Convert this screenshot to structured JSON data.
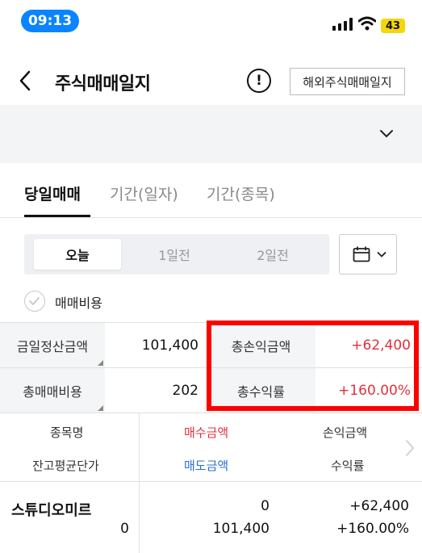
{
  "status_bar": {
    "time": "09:13",
    "battery": "43"
  },
  "header": {
    "title": "주식매매일지",
    "info_icon": "info-circle-icon",
    "overseas_button": "해외주식매매일지"
  },
  "tabs": [
    {
      "label": "당일매매",
      "active": true
    },
    {
      "label": "기간(일자)",
      "active": false
    },
    {
      "label": "기간(종목)",
      "active": false
    }
  ],
  "day_selector": {
    "options": [
      "오늘",
      "1일전",
      "2일전"
    ],
    "selected": "오늘"
  },
  "fee_toggle": {
    "label": "매매비용",
    "checked": false
  },
  "summary": {
    "settlement_label": "금일정산금액",
    "settlement_value": "101,400",
    "total_pl_label": "총손익금액",
    "total_pl_value": "+62,400",
    "total_fee_label": "총매매비용",
    "total_fee_value": "202",
    "total_return_label": "총수익률",
    "total_return_value": "+160.00%"
  },
  "list_header": {
    "col1_top": "종목명",
    "col1_bottom": "잔고평균단가",
    "col2_top": "매수금액",
    "col2_bottom": "매도금액",
    "col3_top": "손익금액",
    "col3_bottom": "수익률"
  },
  "rows": [
    {
      "name": "스튜디오미르",
      "avg_price": "0",
      "buy_amount": "0",
      "sell_amount": "101,400",
      "pl_amount": "+62,400",
      "return_rate": "+160.00%"
    }
  ],
  "colors": {
    "accent_blue": "#0a84ff",
    "profit_red": "#e2303b",
    "sell_blue": "#2c6fcf",
    "highlight": "#ff0000"
  }
}
